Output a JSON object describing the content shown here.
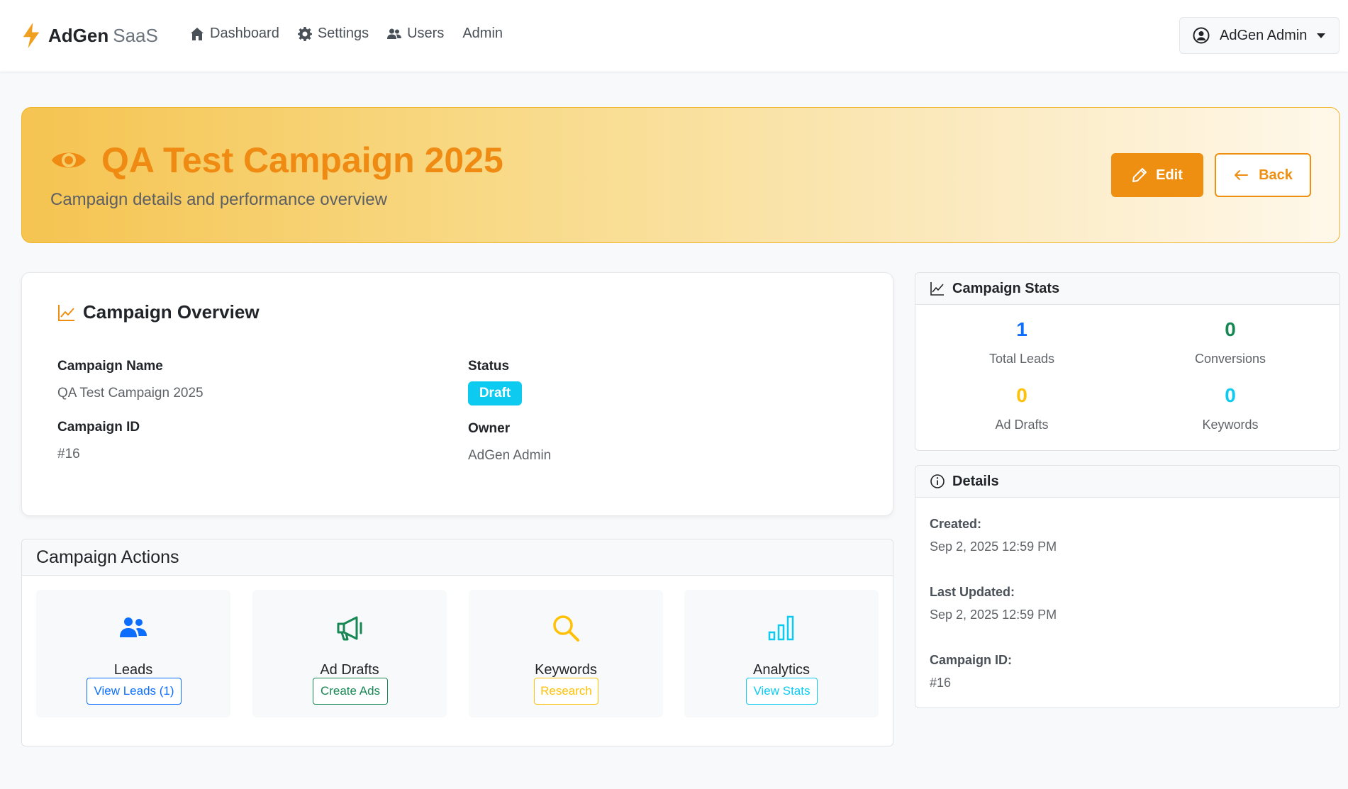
{
  "navbar": {
    "brand_name": "AdGen",
    "brand_sub": "SaaS",
    "links": [
      {
        "label": "Dashboard",
        "icon": "home-icon"
      },
      {
        "label": "Settings",
        "icon": "gear-icon"
      },
      {
        "label": "Users",
        "icon": "users-icon"
      },
      {
        "label": "Admin",
        "icon": ""
      }
    ],
    "user_name": "AdGen Admin"
  },
  "hero": {
    "title": "QA Test Campaign 2025",
    "subtitle": "Campaign details and performance overview",
    "edit_label": "Edit",
    "back_label": "Back"
  },
  "overview": {
    "title": "Campaign Overview",
    "name_label": "Campaign Name",
    "name_value": "QA Test Campaign 2025",
    "id_label": "Campaign ID",
    "id_value": "#16",
    "status_label": "Status",
    "status_value": "Draft",
    "owner_label": "Owner",
    "owner_value": "AdGen Admin"
  },
  "actions": {
    "title": "Campaign Actions",
    "tiles": [
      {
        "name": "Leads",
        "button": "View Leads (1)",
        "icon": "users-icon",
        "color": "#0d6efd"
      },
      {
        "name": "Ad Drafts",
        "button": "Create Ads",
        "icon": "megaphone-icon",
        "color": "#198754"
      },
      {
        "name": "Keywords",
        "button": "Research",
        "icon": "search-icon",
        "color": "#ffc107"
      },
      {
        "name": "Analytics",
        "button": "View Stats",
        "icon": "bar-chart-icon",
        "color": "#0dcaf0"
      }
    ]
  },
  "stats": {
    "title": "Campaign Stats",
    "items": [
      {
        "value": "1",
        "label": "Total Leads",
        "color": "#0d6efd"
      },
      {
        "value": "0",
        "label": "Conversions",
        "color": "#198754"
      },
      {
        "value": "0",
        "label": "Ad Drafts",
        "color": "#ffc107"
      },
      {
        "value": "0",
        "label": "Keywords",
        "color": "#0dcaf0"
      }
    ]
  },
  "details": {
    "title": "Details",
    "created_label": "Created:",
    "created_value": "Sep 2, 2025 12:59 PM",
    "updated_label": "Last Updated:",
    "updated_value": "Sep 2, 2025 12:59 PM",
    "id_label": "Campaign ID:",
    "id_value": "#16"
  },
  "colors": {
    "accent": "#ef8f12",
    "info": "#0dcaf0",
    "primary": "#0d6efd",
    "success": "#198754",
    "warning": "#ffc107"
  }
}
